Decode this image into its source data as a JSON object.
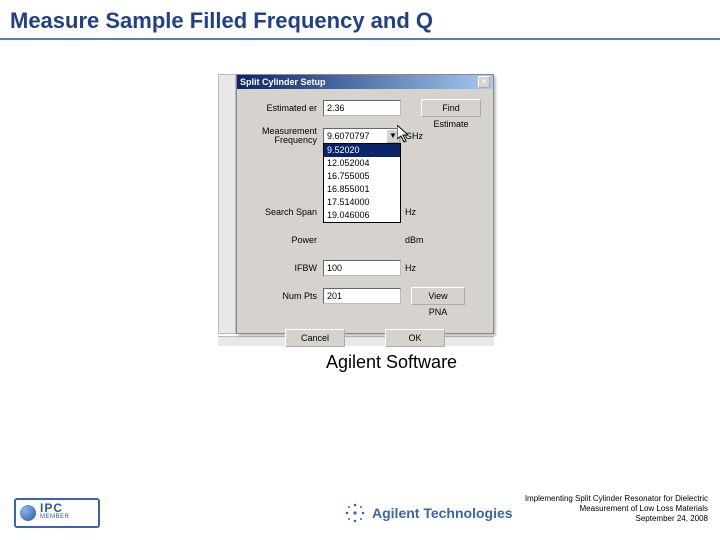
{
  "slide": {
    "title": "Measure Sample Filled Frequency and Q"
  },
  "dialog": {
    "title": "Split Cylinder Setup",
    "labels": {
      "estimated_er": "Estimated er",
      "measurement_frequency": "Measurement Frequency",
      "search_span": "Search Span",
      "power": "Power",
      "ifbw": "IFBW",
      "num_pts": "Num Pts"
    },
    "fields": {
      "estimated_er": "2.36",
      "measurement_frequency": "9.6070797",
      "search_span": "",
      "power": "",
      "ifbw": "100",
      "num_pts": "201"
    },
    "units": {
      "measurement_frequency": "GHz",
      "search_span": "Hz",
      "power": "dBm",
      "ifbw": "Hz"
    },
    "dropdown_options": [
      "9.52020",
      "12.052004",
      "16.755005",
      "16.855001",
      "17.514000",
      "19.046006"
    ],
    "dropdown_selected_index": 0,
    "buttons": {
      "find_estimate": "Find Estimate",
      "view_pna": "View PNA",
      "cancel": "Cancel",
      "ok": "OK"
    }
  },
  "caption": "Agilent Software",
  "footer": {
    "line1": "Implementing Split Cylinder Resonator for Dielectric",
    "line2": "Measurement of Low Loss Materials",
    "line3": "September 24, 2008"
  },
  "logos": {
    "ipc_big": "IPC",
    "ipc_small": "MEMBER",
    "agilent": "Agilent Technologies"
  }
}
